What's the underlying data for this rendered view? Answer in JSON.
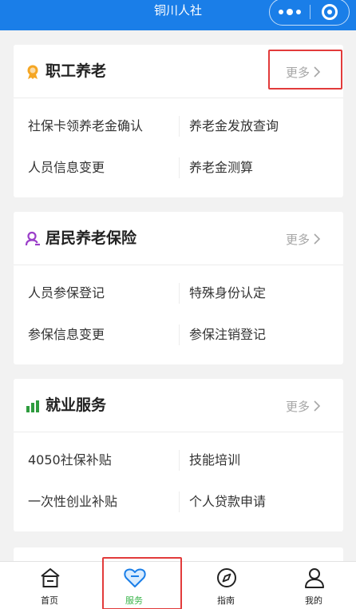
{
  "header": {
    "title": "铜川人社"
  },
  "colors": {
    "primary": "#1a7ee8",
    "active_tab": "#39b54a",
    "highlight": "#e23b3b"
  },
  "cards": [
    {
      "title": "职工养老",
      "icon": "medal-icon",
      "more_label": "更多",
      "items": [
        "社保卡领养老金确认",
        "养老金发放查询",
        "人员信息变更",
        "养老金测算"
      ]
    },
    {
      "title": "居民养老保险",
      "icon": "user-icon",
      "more_label": "更多",
      "items": [
        "人员参保登记",
        "特殊身份认定",
        "参保信息变更",
        "参保注销登记"
      ]
    },
    {
      "title": "就业服务",
      "icon": "bar-chart-icon",
      "more_label": "更多",
      "items": [
        "4050社保补贴",
        "技能培训",
        "一次性创业补贴",
        "个人贷款申请"
      ]
    }
  ],
  "tabbar": {
    "active": "服务",
    "items": [
      {
        "label": "首页",
        "icon": "home-icon"
      },
      {
        "label": "服务",
        "icon": "heart-icon"
      },
      {
        "label": "指南",
        "icon": "compass-icon"
      },
      {
        "label": "我的",
        "icon": "person-icon"
      }
    ]
  }
}
